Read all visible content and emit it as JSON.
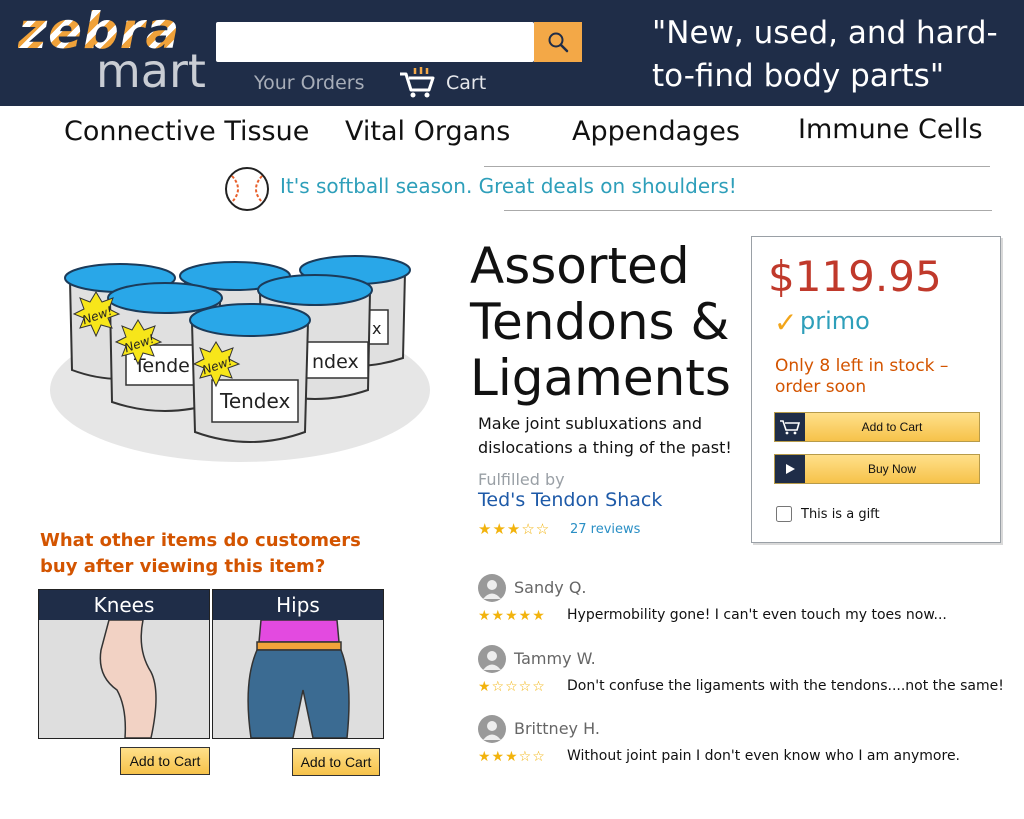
{
  "header": {
    "logo_top": "zebra",
    "logo_bottom": "mart",
    "search_placeholder": "",
    "orders_label": "Your Orders",
    "cart_label": "Cart",
    "tagline": "\"New, used, and hard-to-find body parts\"",
    "colors": {
      "bar": "#1f2d48",
      "search_button": "#f3a847"
    }
  },
  "nav": {
    "items": [
      "Connective Tissue",
      "Vital Organs",
      "Appendages",
      "Immune Cells"
    ]
  },
  "promo": {
    "icon": "softball-icon",
    "text": "It's softball season. Great deals on shoulders!"
  },
  "product": {
    "image_labels": [
      "Tendex",
      "New!"
    ],
    "title": "Assorted Tendons & Ligaments",
    "description": "Make joint subluxations and dislocations a thing of the past!",
    "fulfilled_label": "Fulfilled by",
    "seller": "Ted's Tendon Shack",
    "rating": 3,
    "rating_max": 5,
    "rating_stars": "★★★☆☆",
    "reviews_count": "27 reviews"
  },
  "buy_box": {
    "price": "$119.95",
    "check_icon": "✓",
    "shipping_badge": "primo",
    "stock_text": "Only 8 left in stock – order soon",
    "add_to_cart_label": "Add to Cart",
    "buy_now_label": "Buy Now",
    "gift_label": "This is a gift",
    "gift_checked": false
  },
  "also_viewed": {
    "heading": "What other items do customers buy after viewing this item?",
    "items": [
      {
        "name": "Knees",
        "button": "Add to Cart"
      },
      {
        "name": "Hips",
        "button": "Add to Cart"
      }
    ]
  },
  "reviews": [
    {
      "name": "Sandy Q.",
      "rating": 5,
      "stars": "★★★★★",
      "text": "Hypermobility gone! I can't even touch my toes now..."
    },
    {
      "name": "Tammy W.",
      "rating": 1,
      "stars": "★☆☆☆☆",
      "text": "Don't confuse the ligaments with the tendons....not the same!"
    },
    {
      "name": "Brittney H.",
      "rating": 3,
      "stars": "★★★☆☆",
      "text": "Without joint pain I don't even know who I am anymore."
    }
  ]
}
